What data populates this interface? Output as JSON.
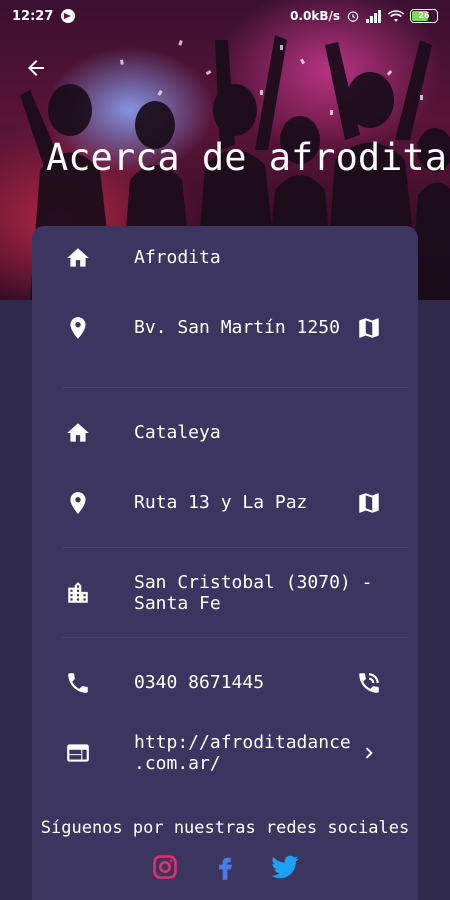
{
  "status_bar": {
    "time": "12:27",
    "network_speed": "0.0kB/s",
    "battery": "26"
  },
  "header": {
    "title": "Acerca de afrodita"
  },
  "locations": [
    {
      "name": "Afrodita",
      "address": "Bv. San Martín 1250"
    },
    {
      "name": "Cataleya",
      "address": "Ruta 13 y La Paz"
    }
  ],
  "city": "San Cristobal (3070) - Santa Fe",
  "city_line1": "San Cristobal (3070) -",
  "city_line2": "Santa Fe",
  "phone": "0340 8671445",
  "website_line1": "http://afroditadance",
  "website_line2": ".com.ar/",
  "social": {
    "title": "Síguenos por nuestras redes sociales",
    "networks": [
      "instagram",
      "facebook",
      "twitter"
    ]
  },
  "colors": {
    "background": "#2f2a4c",
    "card": "#3b3560",
    "instagram": "#e1306c",
    "facebook": "#4a7be6",
    "twitter": "#1da1f2"
  }
}
